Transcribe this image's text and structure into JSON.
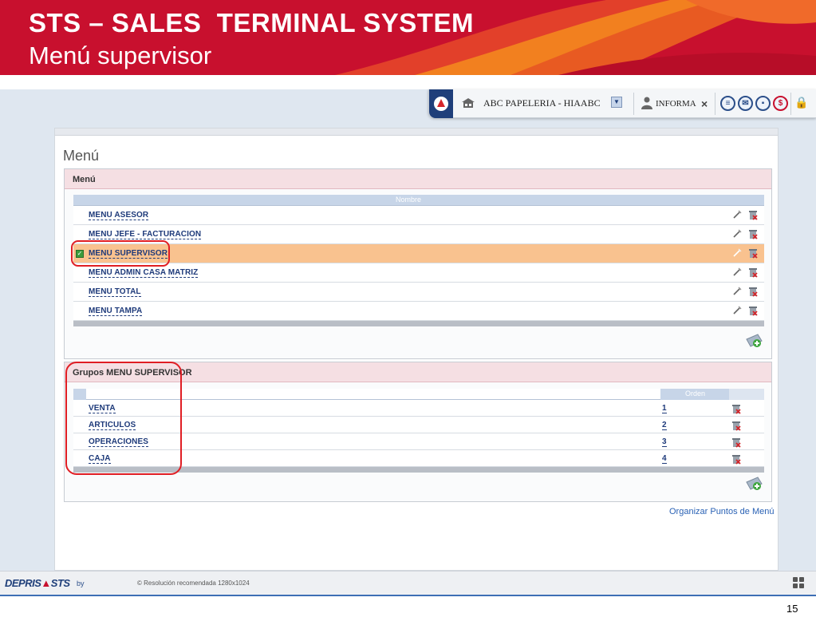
{
  "slide": {
    "title_line1": "STS – SALES  TERMINAL SYSTEM",
    "title_line2": "Menú supervisor",
    "page_number": "15"
  },
  "topbar": {
    "company": "ABC PAPELERIA - HIAABC",
    "user": "INFORMA",
    "close": "×",
    "icons": [
      "chat-icon",
      "mail-icon",
      "lock-icon",
      "dollar-icon"
    ]
  },
  "panel": {
    "title": "Menú",
    "menu_box": {
      "header": "Menú",
      "column_header": "Nombre",
      "rows": [
        {
          "label": "MENU ASESOR",
          "selected": false
        },
        {
          "label": "MENU JEFE - FACTURACION",
          "selected": false
        },
        {
          "label": "MENU SUPERVISOR",
          "selected": true
        },
        {
          "label": "MENU ADMIN CASA MATRIZ",
          "selected": false
        },
        {
          "label": "MENU TOTAL",
          "selected": false
        },
        {
          "label": "MENU TAMPA",
          "selected": false
        }
      ]
    },
    "groups_box": {
      "header": "Grupos MENU SUPERVISOR",
      "column_header": "Orden",
      "rows": [
        {
          "label": "VENTA",
          "order": "1"
        },
        {
          "label": "ARTICULOS",
          "order": "2"
        },
        {
          "label": "OPERACIONES",
          "order": "3"
        },
        {
          "label": "CAJA",
          "order": "4"
        }
      ]
    },
    "organize_link": "Organizar Puntos de Menú"
  },
  "footer": {
    "brand_left": "DEPRIS",
    "brand_right": "STS",
    "by": "by",
    "resolution": "© Resolución recomendada 1280x1024"
  },
  "colors": {
    "banner": "#c8102e",
    "selected_row": "#f9c28f",
    "box_header": "#f5dfe3",
    "link": "#1e3a7a",
    "highlight": "#e01e24"
  }
}
